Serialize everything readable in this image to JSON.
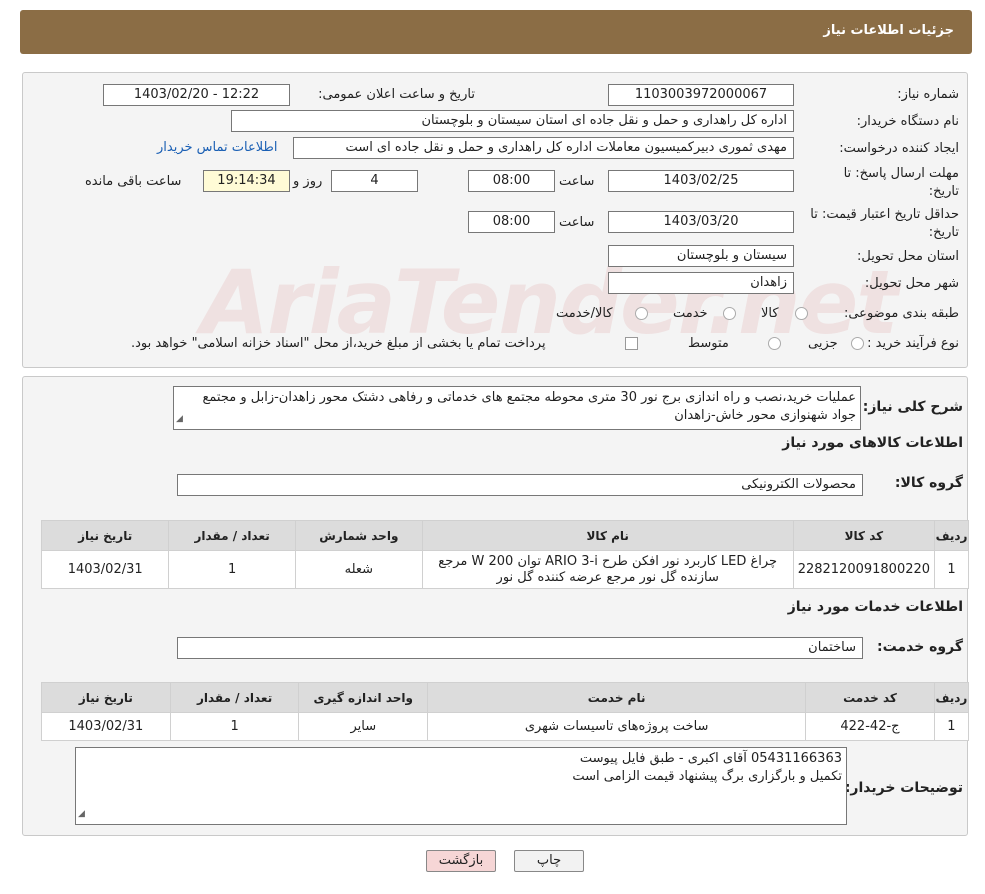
{
  "header": {
    "title": "جزئیات اطلاعات نیاز"
  },
  "form": {
    "need_number_label": "شماره نیاز:",
    "need_number": "1103003972000067",
    "announce_label": "تاریخ و ساعت اعلان عمومی:",
    "announce_value": "1403/02/20 - 12:22",
    "buyer_org_label": "نام دستگاه خریدار:",
    "buyer_org": "اداره کل راهداری و حمل و نقل جاده ای استان سیستان و بلوچستان",
    "creator_label": "ایجاد کننده درخواست:",
    "creator": "مهدی ثموری دبیرکمیسیون معاملات اداره کل راهداری و حمل و نقل جاده ای است",
    "contact_link": "اطلاعات تماس خریدار",
    "deadline_label_1": "مهلت ارسال پاسخ: تا",
    "deadline_label_2": "تاریخ:",
    "deadline_date": "1403/02/25",
    "hour_label": "ساعت",
    "deadline_time": "08:00",
    "days_value": "4",
    "days_label": "روز و",
    "remaining_time": "19:14:34",
    "remaining_label": "ساعت باقی مانده",
    "validity_label_1": "حداقل تاریخ اعتبار قیمت: تا",
    "validity_label_2": "تاریخ:",
    "validity_date": "1403/03/20",
    "validity_time": "08:00",
    "province_label": "استان محل تحویل:",
    "province": "سیستان و بلوچستان",
    "city_label": "شهر محل تحویل:",
    "city": "زاهدان",
    "category_label": "طبقه بندی موضوعی:",
    "cat_goods": "کالا",
    "cat_service": "خدمت",
    "cat_goods_service": "کالا/خدمت",
    "process_label": "نوع فرآیند خرید :",
    "proc_partial": "جزیی",
    "proc_medium": "متوسط",
    "payment_note": "پرداخت تمام یا بخشی از مبلغ خرید،از محل \"اسناد خزانه اسلامی\" خواهد بود."
  },
  "details": {
    "summary_label": "شرح کلی نیاز:",
    "summary": "عملیات خرید،نصب و راه اندازی برج نور 30 متری محوطه مجتمع های خدماتی و رفاهی دشتک محور زاهدان-زابل و مجتمع جواد شهنوازی محور خاش-زاهدان",
    "goods_section": "اطلاعات کالاهای مورد نیاز",
    "goods_group_label": "گروه کالا:",
    "goods_group": "محصولات الکترونیکی",
    "goods_headers": [
      "ردیف",
      "کد کالا",
      "نام کالا",
      "واحد شمارش",
      "تعداد / مقدار",
      "تاریخ نیاز"
    ],
    "goods_row": [
      "1",
      "2282120091800220",
      "چراغ LED کاربرد نور افکن طرح ARIO 3-i توان W 200 مرجع سازنده گل نور مرجع عرضه کننده گل نور",
      "شعله",
      "1",
      "1403/02/31"
    ],
    "services_section": "اطلاعات خدمات مورد نیاز",
    "service_group_label": "گروه خدمت:",
    "service_group": "ساختمان",
    "service_headers": [
      "ردیف",
      "کد خدمت",
      "نام خدمت",
      "واحد اندازه گیری",
      "تعداد / مقدار",
      "تاریخ نیاز"
    ],
    "service_row": [
      "1",
      "ج-42-422",
      "ساخت پروژه‌های تاسیسات شهری",
      "سایر",
      "1",
      "1403/02/31"
    ],
    "buyer_notes_label": "توضیحات خریدار:",
    "buyer_notes_1": "05431166363 آقای اکبری - طبق فایل پیوست",
    "buyer_notes_2": "تکمیل و بارگزاری برگ پیشنهاد قیمت الزامی است"
  },
  "buttons": {
    "print": "چاپ",
    "back": "بازگشت"
  },
  "watermark": "AriaTender.net",
  "colors": {
    "header": "#8b6d45",
    "back_button": "#f6d6d6",
    "link": "#1a5fb4"
  }
}
